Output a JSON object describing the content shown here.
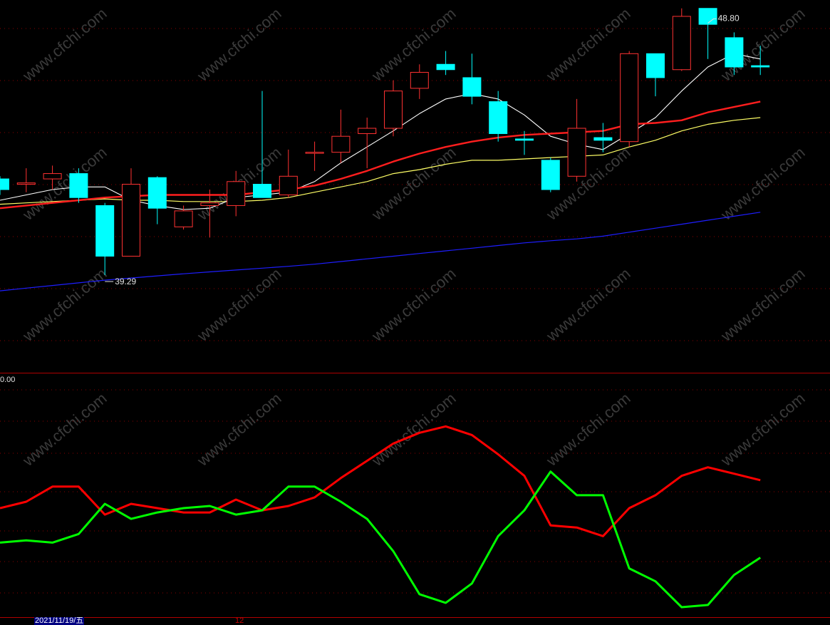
{
  "chart_data": {
    "type": "candlestick",
    "colors": {
      "background": "#000000",
      "up": "#ff3232",
      "down": "#00ffff",
      "ma_short": "#ffffff",
      "ma_mid": "#ff1e1e",
      "ma_long": "#ffff66",
      "ma_xlong": "#1e1eff",
      "osc_red": "#ff0000",
      "osc_green": "#00ff00",
      "grid": "#8b0000",
      "watermark": "#3a3a3a"
    },
    "price_ylim": [
      35.6,
      49.4
    ],
    "candles": [
      {
        "o": 42.9,
        "h": 43.0,
        "l": 42.3,
        "c": 42.5
      },
      {
        "o": 42.7,
        "h": 43.3,
        "l": 42.4,
        "c": 42.75
      },
      {
        "o": 42.9,
        "h": 43.4,
        "l": 42.5,
        "c": 43.1
      },
      {
        "o": 43.1,
        "h": 43.3,
        "l": 42.0,
        "c": 42.2
      },
      {
        "o": 41.9,
        "h": 42.0,
        "l": 39.29,
        "c": 40.0
      },
      {
        "o": 40.0,
        "h": 43.3,
        "l": 40.0,
        "c": 42.7
      },
      {
        "o": 42.95,
        "h": 43.0,
        "l": 41.2,
        "c": 41.8
      },
      {
        "o": 41.1,
        "h": 41.9,
        "l": 41.0,
        "c": 41.7
      },
      {
        "o": 41.9,
        "h": 42.5,
        "l": 40.7,
        "c": 42.0
      },
      {
        "o": 41.9,
        "h": 43.2,
        "l": 41.5,
        "c": 42.8
      },
      {
        "o": 42.7,
        "h": 46.2,
        "l": 42.3,
        "c": 42.2
      },
      {
        "o": 42.3,
        "h": 44.0,
        "l": 42.2,
        "c": 43.0
      },
      {
        "o": 43.9,
        "h": 44.3,
        "l": 43.2,
        "c": 43.9
      },
      {
        "o": 43.9,
        "h": 45.5,
        "l": 43.5,
        "c": 44.5
      },
      {
        "o": 44.6,
        "h": 45.2,
        "l": 43.3,
        "c": 44.8
      },
      {
        "o": 44.8,
        "h": 46.6,
        "l": 44.5,
        "c": 46.2
      },
      {
        "o": 46.3,
        "h": 47.2,
        "l": 45.9,
        "c": 46.9
      },
      {
        "o": 47.2,
        "h": 47.7,
        "l": 46.8,
        "c": 47.0
      },
      {
        "o": 46.7,
        "h": 47.6,
        "l": 45.7,
        "c": 46.0
      },
      {
        "o": 45.8,
        "h": 46.2,
        "l": 44.3,
        "c": 44.6
      },
      {
        "o": 44.4,
        "h": 44.7,
        "l": 43.8,
        "c": 44.35
      },
      {
        "o": 43.6,
        "h": 43.7,
        "l": 42.4,
        "c": 42.5
      },
      {
        "o": 43.0,
        "h": 45.9,
        "l": 42.8,
        "c": 44.8
      },
      {
        "o": 44.45,
        "h": 45.0,
        "l": 43.9,
        "c": 44.35
      },
      {
        "o": 44.3,
        "h": 47.7,
        "l": 44.1,
        "c": 47.6
      },
      {
        "o": 47.6,
        "h": 47.6,
        "l": 46.0,
        "c": 46.7
      },
      {
        "o": 47.0,
        "h": 49.3,
        "l": 46.95,
        "c": 49.0
      },
      {
        "o": 49.3,
        "h": 48.8,
        "l": 47.4,
        "c": 48.7
      },
      {
        "o": 48.2,
        "h": 48.4,
        "l": 46.8,
        "c": 47.1
      },
      {
        "o": 47.15,
        "h": 47.9,
        "l": 46.8,
        "c": 47.1
      }
    ],
    "ma_short": [
      42.1,
      42.3,
      42.5,
      42.6,
      42.6,
      42.1,
      41.9,
      41.75,
      41.8,
      42.2,
      42.3,
      42.4,
      42.8,
      43.5,
      44.1,
      44.7,
      45.35,
      45.9,
      46.1,
      45.9,
      45.3,
      44.5,
      44.2,
      44.0,
      44.6,
      45.2,
      46.2,
      47.1,
      47.6,
      47.4
    ],
    "ma_mid": [
      41.8,
      41.9,
      42.0,
      42.1,
      42.2,
      42.25,
      42.3,
      42.3,
      42.3,
      42.3,
      42.4,
      42.5,
      42.65,
      42.9,
      43.2,
      43.55,
      43.85,
      44.1,
      44.3,
      44.45,
      44.55,
      44.6,
      44.65,
      44.7,
      44.95,
      45.0,
      45.1,
      45.4,
      45.6,
      45.8
    ],
    "ma_long": [
      41.95,
      42.0,
      42.05,
      42.1,
      42.15,
      42.1,
      42.1,
      42.05,
      42.05,
      42.05,
      42.1,
      42.2,
      42.4,
      42.6,
      42.8,
      43.1,
      43.25,
      43.45,
      43.6,
      43.6,
      43.65,
      43.7,
      43.75,
      43.8,
      44.1,
      44.35,
      44.7,
      44.95,
      45.1,
      45.2
    ],
    "ma_xlong": [
      38.7,
      38.8,
      38.9,
      39.0,
      39.1,
      39.18,
      39.26,
      39.34,
      39.41,
      39.48,
      39.55,
      39.62,
      39.7,
      39.8,
      39.9,
      40.0,
      40.1,
      40.2,
      40.3,
      40.4,
      40.5,
      40.58,
      40.65,
      40.75,
      40.9,
      41.05,
      41.2,
      41.35,
      41.5,
      41.65
    ],
    "price_labels": {
      "high": "48.80",
      "low": "39.29"
    },
    "osc_ylim": [
      0,
      100
    ],
    "osc_red": [
      48,
      51,
      58,
      58,
      45,
      50,
      48,
      46,
      46,
      52,
      47,
      49,
      53,
      62,
      70,
      78,
      83,
      86,
      82,
      73,
      63,
      40,
      39,
      35,
      48,
      54,
      63,
      67,
      64,
      61
    ],
    "osc_green": [
      32,
      33,
      32,
      36,
      50,
      43,
      46,
      48,
      49,
      45,
      47,
      58,
      58,
      51,
      43,
      28,
      8,
      4,
      13,
      35,
      47,
      65,
      54,
      54,
      20,
      14,
      2,
      3,
      17,
      25
    ],
    "axis_label": "0.00",
    "date_label": "2021/11/19/五",
    "mid_mark": "12",
    "watermark": "www.cfchi.com"
  }
}
